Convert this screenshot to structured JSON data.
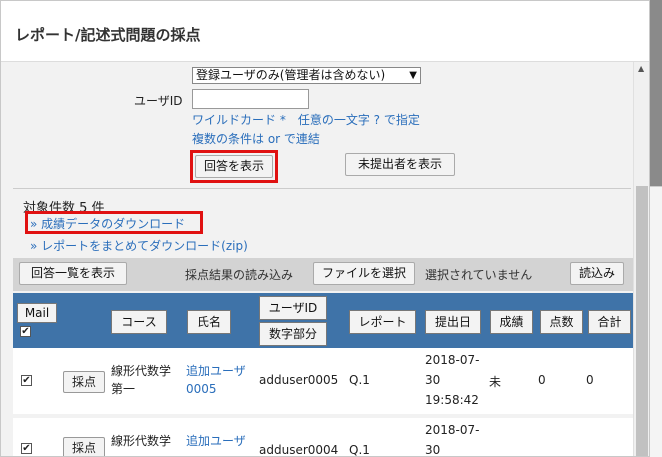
{
  "dialog": {
    "title": "レポート/記述式問題の採点"
  },
  "filter": {
    "select_value": "登録ユーザのみ(管理者は含めない)",
    "userid_label": "ユーザID",
    "userid_value": "",
    "hint1": "ワイルドカード *　任意の一文字 ? で指定",
    "hint2": "複数の条件は or で連結",
    "show_answers": "回答を表示",
    "show_unsubmitted": "未提出者を表示"
  },
  "summary": {
    "count": "対象件数 5 件",
    "download_grades": "» 成績データのダウンロード",
    "download_reports": "» レポートをまとめてダウンロード(zip)"
  },
  "toolbar": {
    "answer_list": "回答一覧を表示",
    "import_label": "採点結果の読み込み",
    "choose_file": "ファイルを選択",
    "no_file": "選択されていません",
    "load": "読込み"
  },
  "columns": {
    "mail": "Mail",
    "course": "コース",
    "name": "氏名",
    "userid": "ユーザID",
    "digits": "数字部分",
    "report": "レポート",
    "submit_date": "提出日",
    "grade": "成績",
    "points": "点数",
    "total": "合計"
  },
  "rows": [
    {
      "checked": "✔",
      "score_btn": "採点",
      "course_l1": "線形代数学",
      "course_l2": "第一",
      "name_l1": "追加ユーザ",
      "name_l2": "0005",
      "userid": "adduser0005",
      "report": "Q.1",
      "date_l1": "2018-07-",
      "date_l2": "30",
      "date_l3": "19:58:42",
      "grade": "未",
      "points": "0",
      "total": "0"
    },
    {
      "checked": "✔",
      "score_btn": "採点",
      "course_l1": "線形代数学",
      "name_l1": "追加ユーザ",
      "userid": "adduser0004",
      "report": "Q.1",
      "date_l1": "2018-07-",
      "date_l2": "30"
    }
  ],
  "colors": {
    "header": "#3f73a8",
    "highlight": "#e01111",
    "link": "#2a6ebb"
  }
}
